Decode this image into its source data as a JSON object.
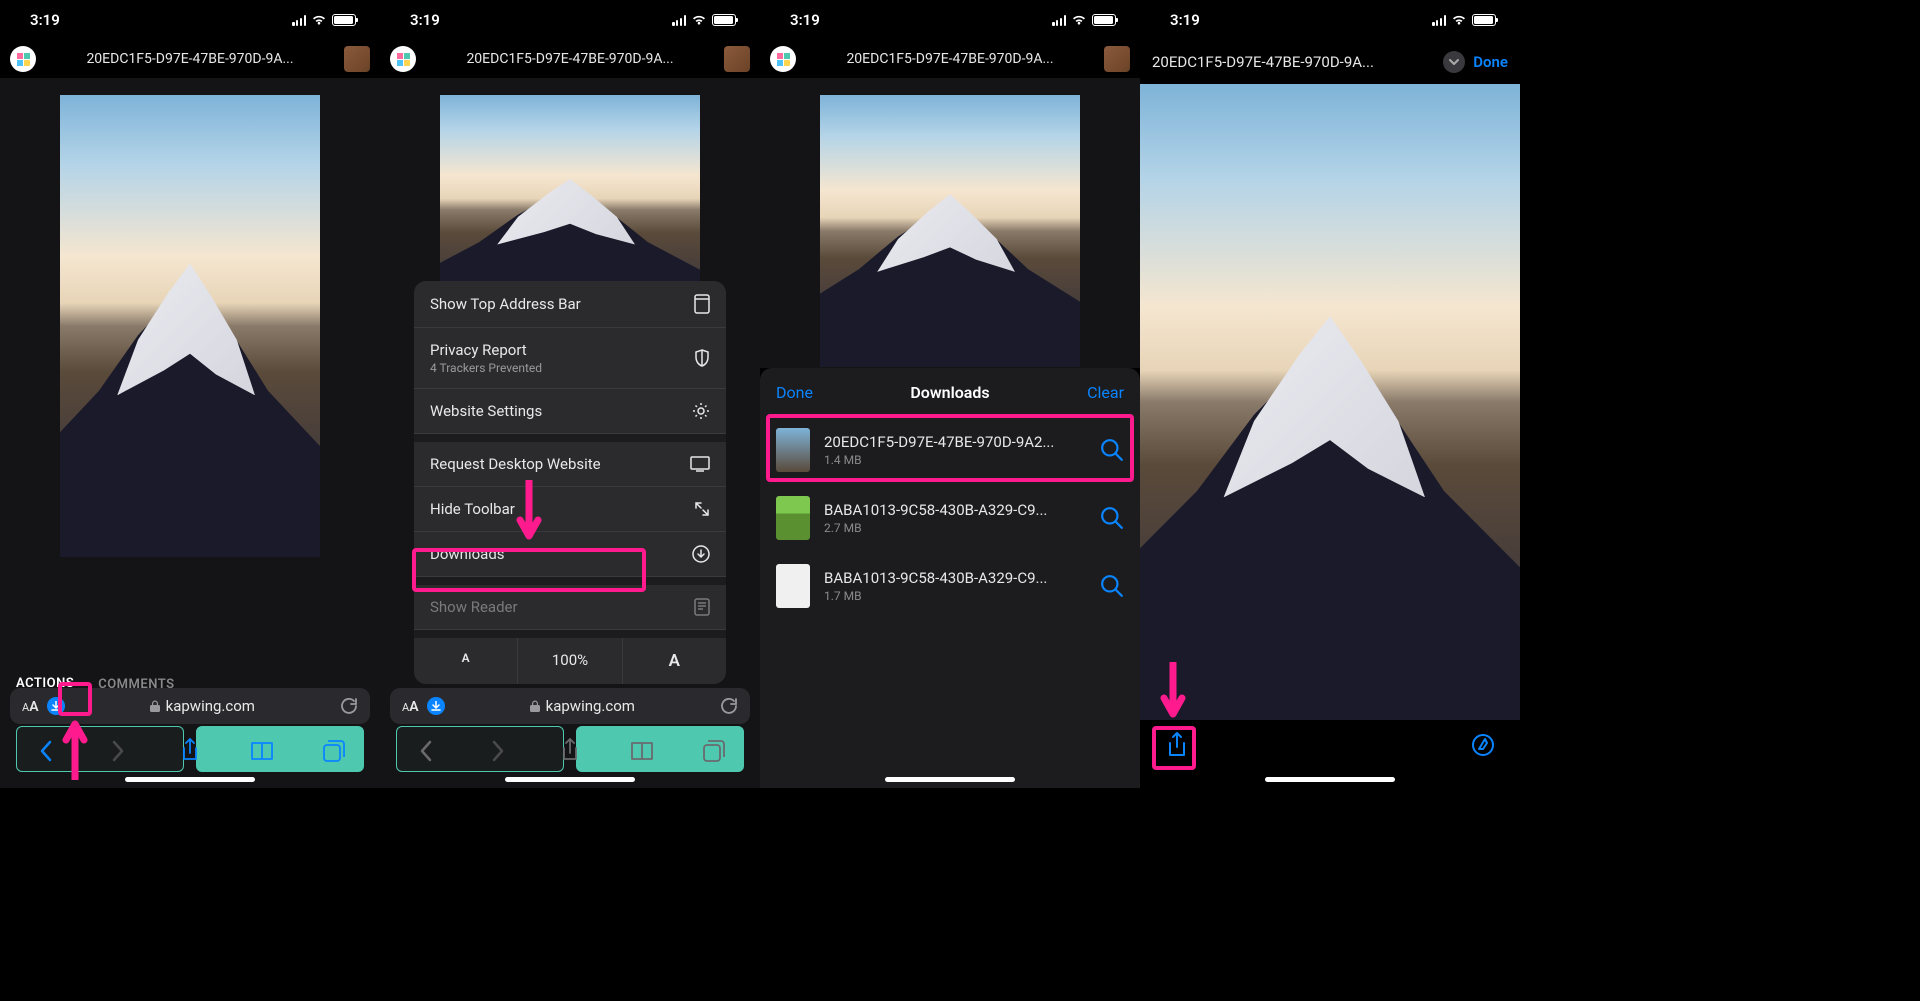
{
  "status": {
    "time": "3:19"
  },
  "file_title": "20EDC1F5-D97E-47BE-970D-9A...",
  "tabs": {
    "actions": "ACTIONS",
    "comments": "COMMENTS"
  },
  "url": {
    "aa": "AA",
    "domain": "kapwing.com"
  },
  "menu": {
    "show_top": "Show Top Address Bar",
    "privacy": "Privacy Report",
    "privacy_sub": "4 Trackers Prevented",
    "website_settings": "Website Settings",
    "request_desktop": "Request Desktop Website",
    "hide_toolbar": "Hide Toolbar",
    "downloads": "Downloads",
    "show_reader": "Show Reader",
    "zoom": "100%"
  },
  "downloads": {
    "done": "Done",
    "title": "Downloads",
    "clear": "Clear",
    "items": [
      {
        "name": "20EDC1F5-D97E-47BE-970D-9A2...",
        "size": "1.4 MB"
      },
      {
        "name": "BABA1013-9C58-430B-A329-C9...",
        "size": "2.7 MB"
      },
      {
        "name": "BABA1013-9C58-430B-A329-C9...",
        "size": "1.7 MB"
      }
    ]
  },
  "p4": {
    "done": "Done"
  }
}
